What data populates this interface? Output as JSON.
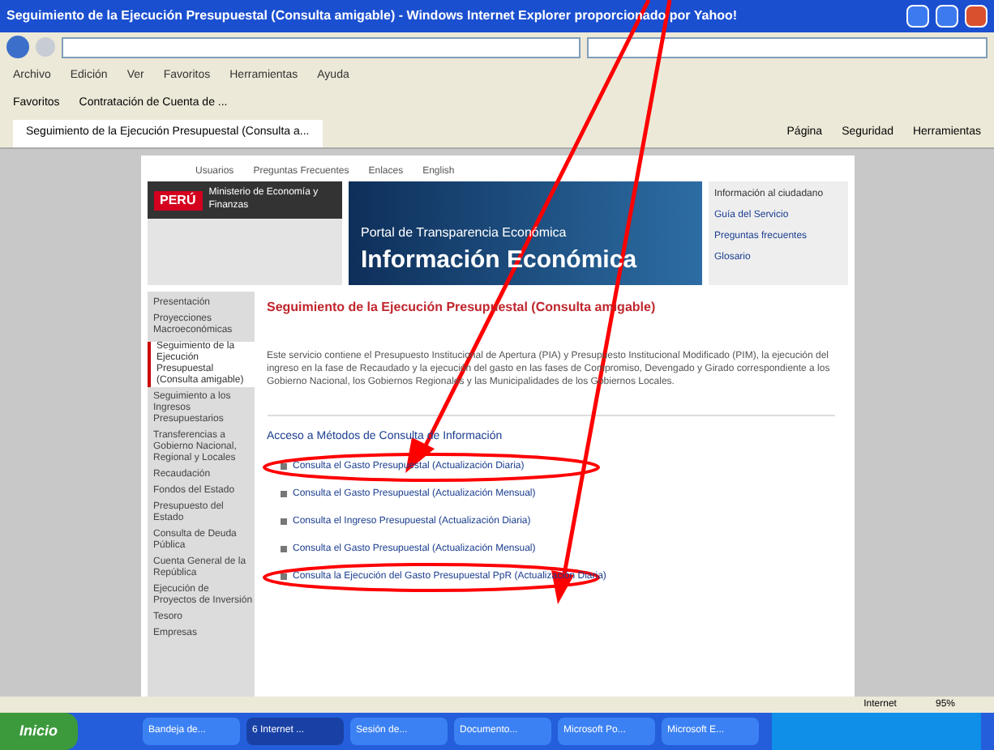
{
  "window": {
    "title": "Seguimiento de la Ejecución Presupuestal (Consulta amigable) - Windows Internet Explorer proporcionado por Yahoo!"
  },
  "menu_bar": [
    "Archivo",
    "Edición",
    "Ver",
    "Favoritos",
    "Herramientas",
    "Ayuda"
  ],
  "favorites_bar": {
    "label": "Favoritos",
    "links": [
      "Contratación de Cuenta de ..."
    ]
  },
  "tab": {
    "title": "Seguimiento de la Ejecución Presupuestal (Consulta a...",
    "selected": true
  },
  "command_bar": [
    "Página",
    "Seguridad",
    "Herramientas"
  ],
  "page": {
    "top_links": [
      "Usuarios",
      "Preguntas Frecuentes",
      "Enlaces",
      "English"
    ],
    "logo": "PERÚ",
    "ministry": "Ministerio de Economía y Finanzas",
    "banner": {
      "subtitle": "Portal de Transparencia Económica",
      "title": "Información Económica"
    },
    "side_panel": {
      "title": "Información al ciudadano",
      "links": [
        "Guía del Servicio",
        "Preguntas frecuentes",
        "Glosario"
      ]
    },
    "sidebar": [
      {
        "label": "Presentación",
        "selected": false
      },
      {
        "label": "Proyecciones Macroeconómicas",
        "selected": false
      },
      {
        "label": "Seguimiento de la Ejecución Presupuestal (Consulta amigable)",
        "selected": true
      },
      {
        "label": "Seguimiento a los Ingresos Presupuestarios",
        "selected": false
      },
      {
        "label": "Transferencias a Gobierno Nacional, Regional y Locales",
        "selected": false
      },
      {
        "label": "Recaudación",
        "selected": false
      },
      {
        "label": "Fondos del Estado",
        "selected": false
      },
      {
        "label": "Presupuesto del Estado",
        "selected": false
      },
      {
        "label": "Consulta de Deuda Pública",
        "selected": false
      },
      {
        "label": "Cuenta General de la República",
        "selected": false
      },
      {
        "label": "Ejecución de Proyectos de Inversión",
        "selected": false
      },
      {
        "label": "Tesoro",
        "selected": false
      },
      {
        "label": "Empresas",
        "selected": false
      }
    ],
    "heading": "Seguimiento de la Ejecución Presupuestal (Consulta amigable)",
    "intro": "Este servicio contiene el Presupuesto Institucional de Apertura (PIA) y Presupuesto Institucional Modificado (PIM), la ejecución del ingreso en la fase de Recaudado y la ejecución del gasto en las fases de Compromiso, Devengado y Girado correspondiente a los Gobierno Nacional, los Gobiernos Regionales y las Municipalidades de los Gobiernos Locales.",
    "section_title": "Acceso a Métodos de Consulta de Información",
    "links": [
      {
        "label": "Consulta el Gasto Presupuestal (Actualización Diaria)",
        "highlighted": true
      },
      {
        "label": "Consulta el Gasto Presupuestal (Actualización Mensual)",
        "highlighted": false
      },
      {
        "label": "Consulta el Ingreso Presupuestal (Actualización Diaria)",
        "highlighted": false
      },
      {
        "label": "Consulta el Gasto Presupuestal (Actualización Mensual)",
        "highlighted": false
      },
      {
        "label": "Consulta la Ejecución del Gasto Presupuestal PpR (Actualización Diaria)",
        "highlighted": true
      }
    ]
  },
  "status_bar": {
    "zone": "Internet",
    "zoom": "95%"
  },
  "taskbar": {
    "start": "Inicio",
    "tasks": [
      {
        "label": "Bandeja de...",
        "selected": false
      },
      {
        "label": "6 Internet ...",
        "selected": true
      },
      {
        "label": "Sesión de...",
        "selected": false
      },
      {
        "label": "Documento...",
        "selected": false
      },
      {
        "label": "Microsoft Po...",
        "selected": false
      },
      {
        "label": "Microsoft E...",
        "selected": false
      }
    ]
  }
}
